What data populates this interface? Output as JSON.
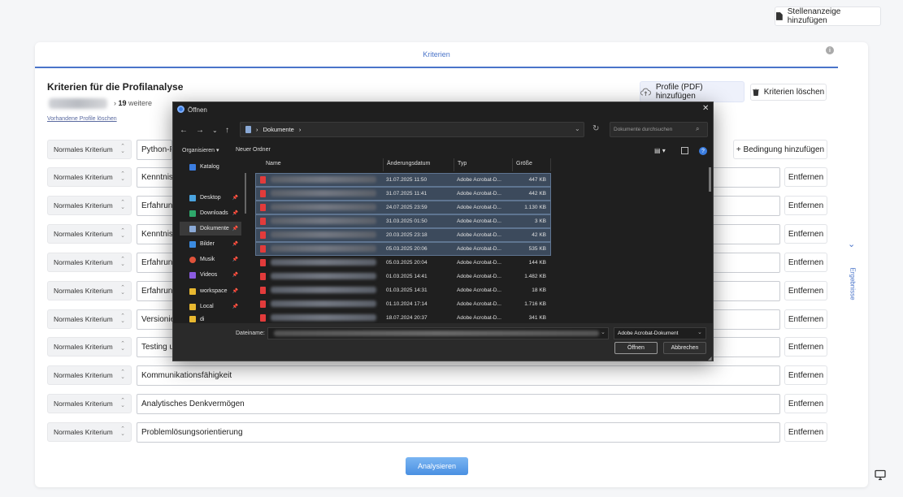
{
  "header": {
    "add_job_ad_label": "Stellenanzeige hinzufügen"
  },
  "tabs": [
    {
      "label": "Kriterien",
      "active": true
    }
  ],
  "criteria": {
    "title": "Kriterien für die Profilanalyse",
    "more_prefix": "›",
    "more_count": "19",
    "more_suffix": "weitere",
    "delete_profiles_link": "Vorhandene Profile löschen",
    "add_pdf_label": "Profile (PDF) hinzufügen",
    "delete_criteria_label": "Kriterien löschen",
    "add_condition_label": "+ Bedingung hinzufügen",
    "remove_label": "Entfernen",
    "rows": [
      {
        "type": "Normales Kriterium",
        "value": "Python-P"
      },
      {
        "type": "Normales Kriterium",
        "value": "Kenntniss"
      },
      {
        "type": "Normales Kriterium",
        "value": "Erfahrung"
      },
      {
        "type": "Normales Kriterium",
        "value": "Kenntniss"
      },
      {
        "type": "Normales Kriterium",
        "value": "Erfahrung"
      },
      {
        "type": "Normales Kriterium",
        "value": "Erfahrung"
      },
      {
        "type": "Normales Kriterium",
        "value": "Versionie"
      },
      {
        "type": "Normales Kriterium",
        "value": "Testing u"
      },
      {
        "type": "Normales Kriterium",
        "value": "Kommunikationsfähigkeit"
      },
      {
        "type": "Normales Kriterium",
        "value": "Analytisches Denkvermögen"
      },
      {
        "type": "Normales Kriterium",
        "value": "Problemlösungsorientierung"
      }
    ],
    "analyze_label": "Analysieren"
  },
  "sidebar": {
    "results_label": "Ergebnisse"
  },
  "dialog": {
    "title": "Öffnen",
    "path": "Dokumente",
    "search_placeholder": "Dokumente durchsuchen",
    "organize_label": "Organisieren",
    "new_folder_label": "Neuer Ordner",
    "nav_items": [
      {
        "label": "Katalog",
        "icon": "catalog-icon",
        "color": "#3b7de0",
        "pinned": false
      },
      {
        "label": "Desktop",
        "icon": "desktop-icon",
        "color": "#4aa3df",
        "pinned": true
      },
      {
        "label": "Downloads",
        "icon": "download-icon",
        "color": "#2ea86b",
        "pinned": true
      },
      {
        "label": "Dokumente",
        "icon": "document-icon",
        "color": "#8aa9d6",
        "pinned": true,
        "selected": true
      },
      {
        "label": "Bilder",
        "icon": "image-icon",
        "color": "#3b8be0",
        "pinned": true
      },
      {
        "label": "Musik",
        "icon": "music-icon",
        "color": "#e0533b",
        "pinned": true
      },
      {
        "label": "Videos",
        "icon": "video-icon",
        "color": "#8a5be0",
        "pinned": true
      },
      {
        "label": "workspace",
        "icon": "folder-icon",
        "color": "#e8b830",
        "pinned": true
      },
      {
        "label": "Local",
        "icon": "folder-icon",
        "color": "#e8b830",
        "pinned": true
      },
      {
        "label": "di",
        "icon": "folder-icon",
        "color": "#e8b830",
        "pinned": false
      }
    ],
    "columns": {
      "name": "Name",
      "date": "Änderungsdatum",
      "type": "Typ",
      "size": "Größe"
    },
    "files": [
      {
        "date": "31.07.2025 11:50",
        "type": "Adobe Acrobat-D...",
        "size": "447 KB",
        "selected": true
      },
      {
        "date": "31.07.2025 11:41",
        "type": "Adobe Acrobat-D...",
        "size": "442 KB",
        "selected": true
      },
      {
        "date": "24.07.2025 23:59",
        "type": "Adobe Acrobat-D...",
        "size": "1.130 KB",
        "selected": true
      },
      {
        "date": "31.03.2025 01:50",
        "type": "Adobe Acrobat-D...",
        "size": "3 KB",
        "selected": true
      },
      {
        "date": "20.03.2025 23:18",
        "type": "Adobe Acrobat-D...",
        "size": "42 KB",
        "selected": true
      },
      {
        "date": "05.03.2025 20:06",
        "type": "Adobe Acrobat-D...",
        "size": "535 KB",
        "selected": true
      },
      {
        "date": "05.03.2025 20:04",
        "type": "Adobe Acrobat-D...",
        "size": "144 KB",
        "selected": false
      },
      {
        "date": "01.03.2025 14:41",
        "type": "Adobe Acrobat-D...",
        "size": "1.482 KB",
        "selected": false
      },
      {
        "date": "01.03.2025 14:31",
        "type": "Adobe Acrobat-D...",
        "size": "18 KB",
        "selected": false
      },
      {
        "date": "01.10.2024 17:14",
        "type": "Adobe Acrobat-D...",
        "size": "1.716 KB",
        "selected": false
      },
      {
        "date": "18.07.2024 20:37",
        "type": "Adobe Acrobat-D...",
        "size": "341 KB",
        "selected": false
      }
    ],
    "filename_label": "Dateiname:",
    "filetype": "Adobe Acrobat-Dokument",
    "open_label": "Öffnen",
    "cancel_label": "Abbrechen"
  },
  "colors": {
    "accent": "#4a74c9",
    "analyze": "#4a90e2",
    "pdf": "#e23b3b"
  }
}
